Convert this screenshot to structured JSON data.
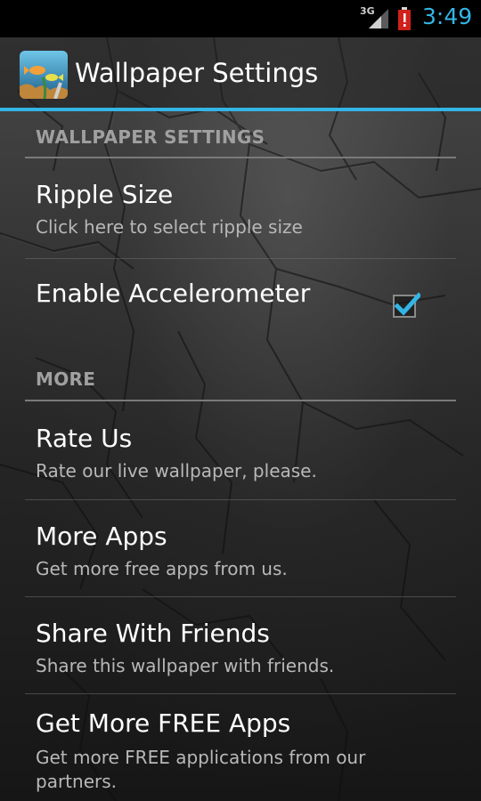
{
  "status_bar": {
    "network": "3G",
    "time": "3:49",
    "icons": [
      "signal-icon",
      "battery-alert-icon"
    ],
    "accent_color": "#33b5e5"
  },
  "action_bar": {
    "title": "Wallpaper Settings",
    "icon": "app-icon"
  },
  "sections": [
    {
      "header": "WALLPAPER SETTINGS",
      "items": [
        {
          "title": "Ripple Size",
          "summary": "Click here to select ripple size"
        },
        {
          "title": "Enable Accelerometer",
          "summary": "",
          "checked": true
        }
      ]
    },
    {
      "header": "MORE",
      "items": [
        {
          "title": "Rate Us",
          "summary": "Rate our live wallpaper, please."
        },
        {
          "title": "More Apps",
          "summary": "Get more free apps from us."
        },
        {
          "title": "Share With Friends",
          "summary": "Share this wallpaper with friends."
        },
        {
          "title": "Get More FREE Apps",
          "summary": "Get more FREE applications from our partners."
        }
      ]
    }
  ]
}
